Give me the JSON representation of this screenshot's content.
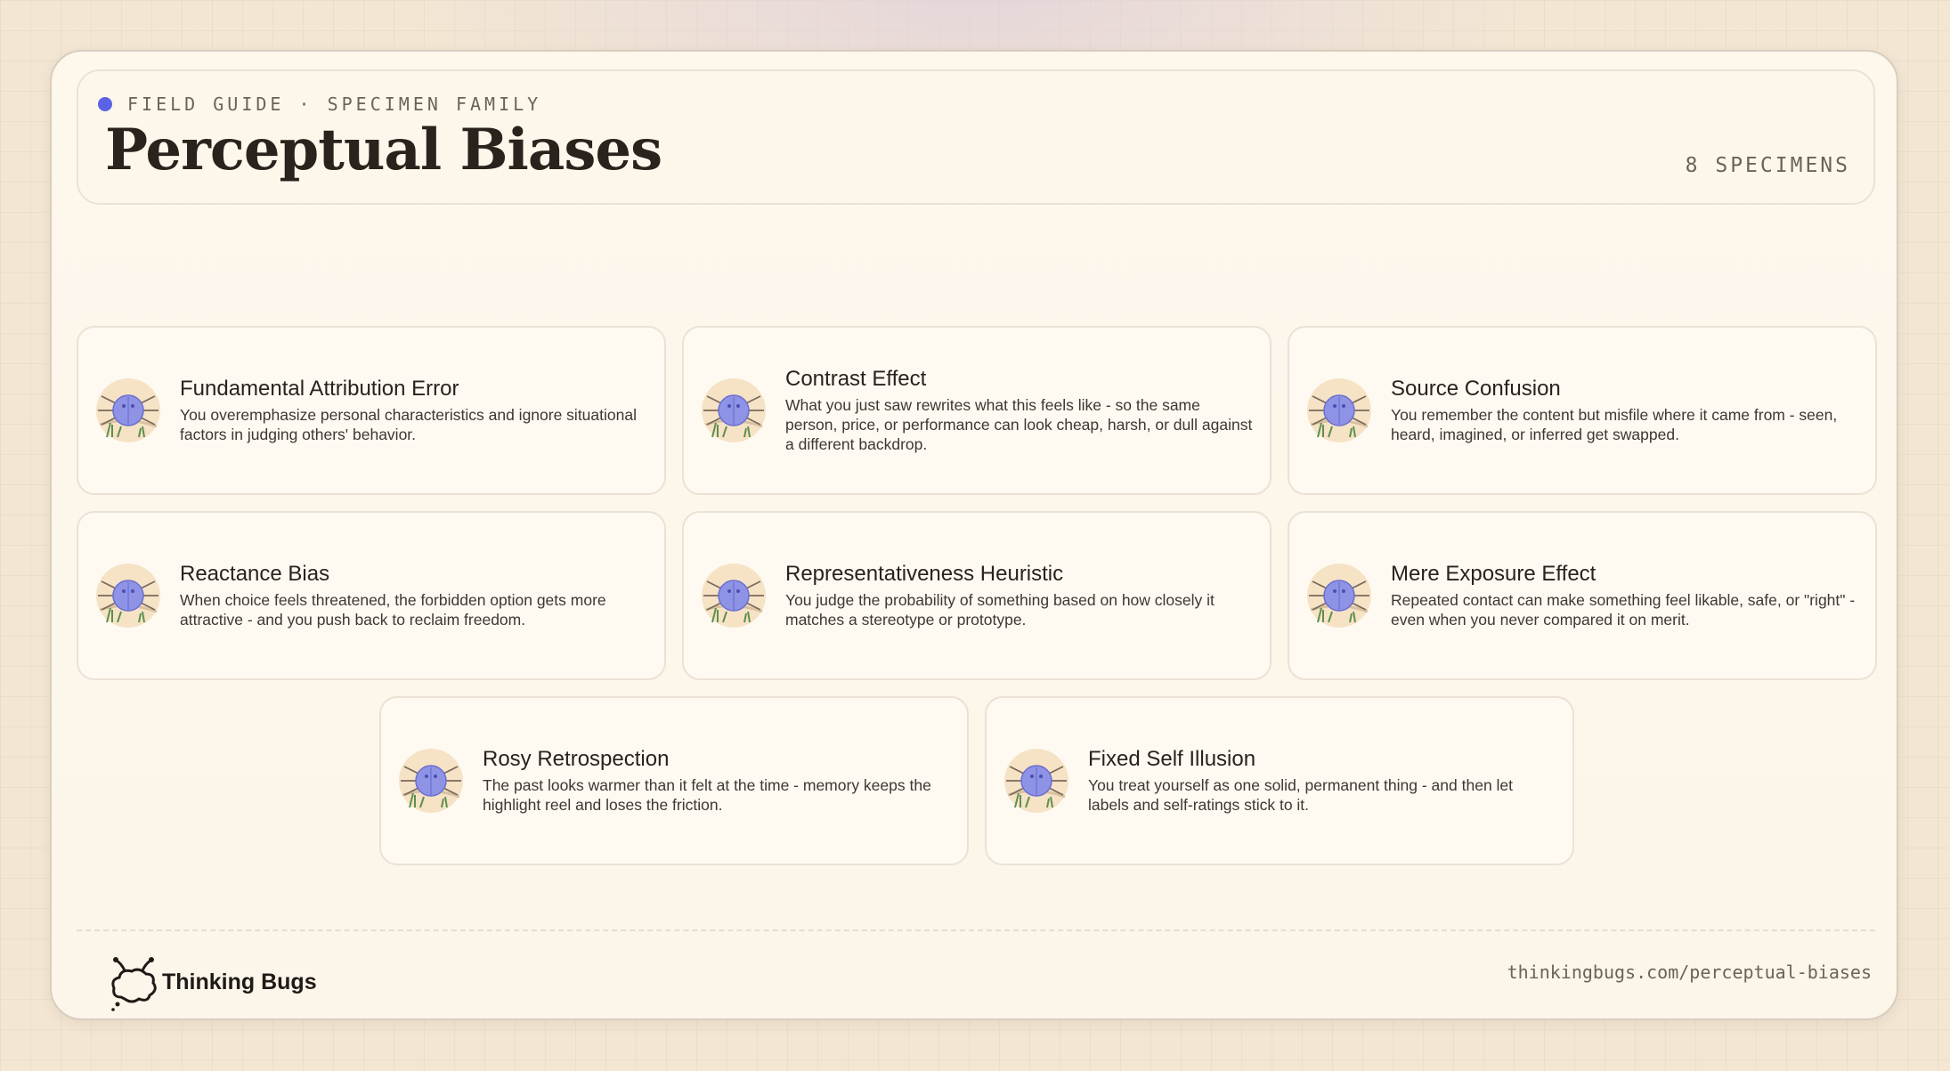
{
  "header": {
    "eyebrow": "FIELD GUIDE · SPECIMEN FAMILY",
    "title": "Perceptual Biases",
    "count": "8 SPECIMENS"
  },
  "specimens": [
    {
      "title": "Fundamental Attribution Error",
      "description": "You overemphasize personal characteristics and ignore situational factors in judging others' behavior.",
      "icon": "bug-icon"
    },
    {
      "title": "Contrast Effect",
      "description": "What you just saw rewrites what this feels like - so the same person, price, or performance can look cheap, harsh, or dull against a different backdrop.",
      "icon": "bug-icon"
    },
    {
      "title": "Source Confusion",
      "description": "You remember the content but misfile where it came from - seen, heard, imagined, or inferred get swapped.",
      "icon": "bug-icon"
    },
    {
      "title": "Reactance Bias",
      "description": "When choice feels threatened, the forbidden option gets more attractive - and you push back to reclaim freedom.",
      "icon": "bug-icon"
    },
    {
      "title": "Representativeness Heuristic",
      "description": "You judge the probability of something based on how closely it matches a stereotype or prototype.",
      "icon": "bug-icon"
    },
    {
      "title": "Mere Exposure Effect",
      "description": "Repeated contact can make something feel likable, safe, or \"right\" - even when you never compared it on merit.",
      "icon": "bug-icon"
    },
    {
      "title": "Rosy Retrospection",
      "description": "The past looks warmer than it felt at the time - memory keeps the highlight reel and loses the friction.",
      "icon": "bug-icon"
    },
    {
      "title": "Fixed Self Illusion",
      "description": "You treat yourself as one solid, permanent thing - and then let labels and self-ratings stick to it.",
      "icon": "bug-icon"
    }
  ],
  "footer": {
    "brand": "Thinking Bugs",
    "url": "thinkingbugs.com/perceptual-biases"
  },
  "colors": {
    "accent": "#5a63e6",
    "bug_body": "#8f93e6",
    "bug_halo": "#f6e3c6",
    "grass": "#5f8f4e"
  }
}
